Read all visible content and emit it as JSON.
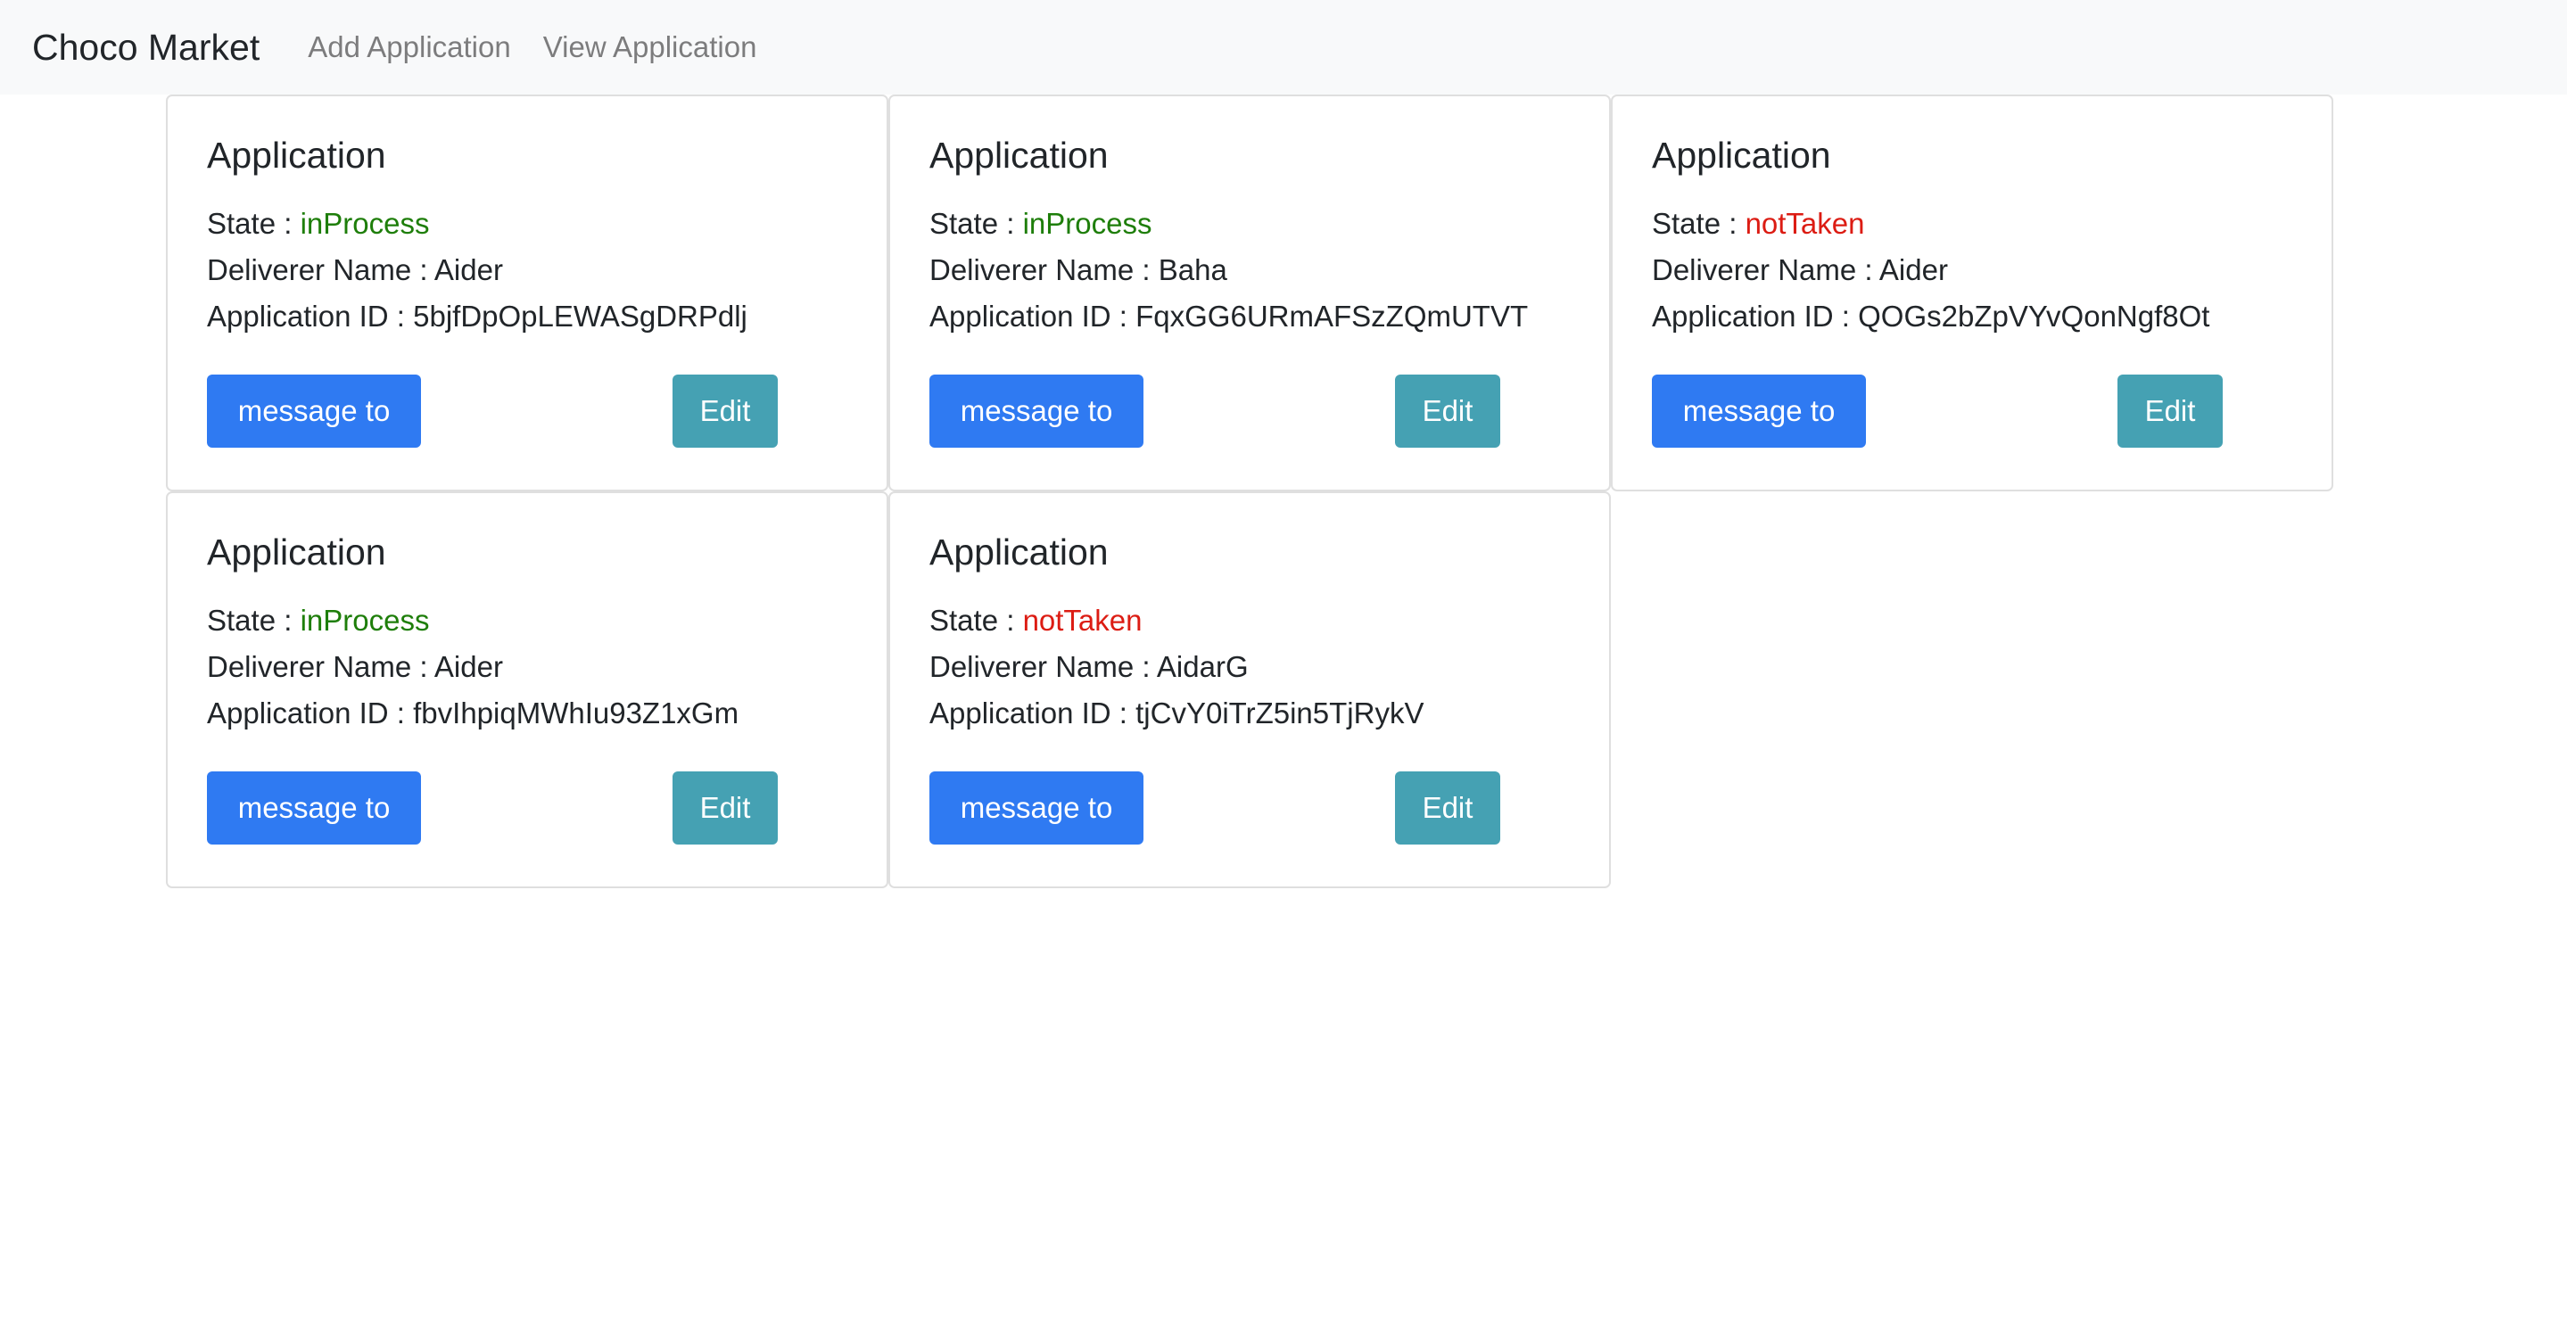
{
  "navbar": {
    "brand": "Choco Market",
    "links": [
      "Add Application",
      "View Application"
    ]
  },
  "labels": {
    "state": "State : ",
    "deliverer": "Deliverer Name : ",
    "app_id": "Application ID : "
  },
  "colors": {
    "inProcess": "#1e7e0a",
    "notTaken": "#dc1c13",
    "primary_button": "#2f7af2",
    "info_button": "#45a1b3"
  },
  "cards": [
    {
      "title": "Application",
      "state": "inProcess",
      "deliverer": "Aider",
      "app_id": "5bjfDpOpLEWASgDRPdlj",
      "message_label": "message to",
      "edit_label": "Edit"
    },
    {
      "title": "Application",
      "state": "inProcess",
      "deliverer": "Baha",
      "app_id": "FqxGG6URmAFSzZQmUTVT",
      "message_label": "message to",
      "edit_label": "Edit"
    },
    {
      "title": "Application",
      "state": "notTaken",
      "deliverer": "Aider",
      "app_id": "QOGs2bZpVYvQonNgf8Ot",
      "message_label": "message to",
      "edit_label": "Edit"
    },
    {
      "title": "Application",
      "state": "inProcess",
      "deliverer": "Aider",
      "app_id": "fbvIhpiqMWhIu93Z1xGm",
      "message_label": "message to",
      "edit_label": "Edit"
    },
    {
      "title": "Application",
      "state": "notTaken",
      "deliverer": "AidarG",
      "app_id": "tjCvY0iTrZ5in5TjRykV",
      "message_label": "message to",
      "edit_label": "Edit"
    }
  ]
}
